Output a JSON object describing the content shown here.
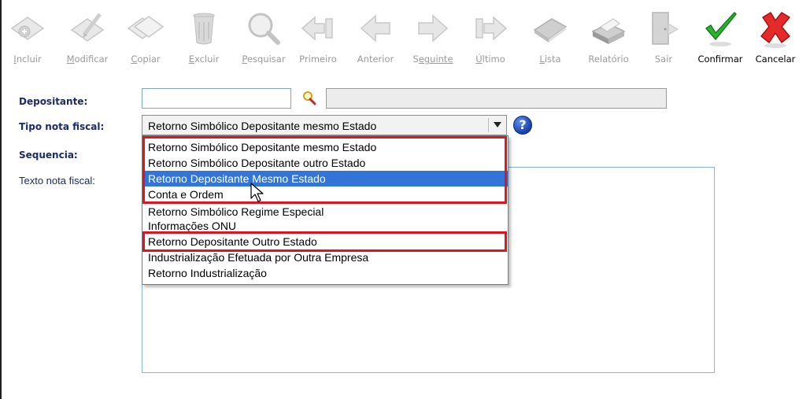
{
  "toolbar": {
    "buttons": [
      {
        "label": "Incluir",
        "ul": "I",
        "rest": "ncluir",
        "active": false
      },
      {
        "label": "Modificar",
        "ul": "M",
        "rest": "odificar",
        "active": false
      },
      {
        "label": "Copiar",
        "ul": "C",
        "rest": "opiar",
        "active": false
      },
      {
        "label": "Excluir",
        "ul": "E",
        "rest": "xcluir",
        "active": false
      },
      {
        "label": "Pesquisar",
        "ul": "P",
        "rest": "esquisar",
        "active": false
      },
      {
        "label": "Primeiro",
        "ul": "",
        "rest": "Primeiro",
        "active": false
      },
      {
        "label": "Anterior",
        "ul": "A",
        "rest": "nterior",
        "active": false
      },
      {
        "label": "Seguinte",
        "ul": "S",
        "rest": "eguinte",
        "active": false
      },
      {
        "label": "Último",
        "ul": "Ú",
        "rest": "ltimo",
        "active": false
      },
      {
        "label": "Lista",
        "ul": "L",
        "rest": "ista",
        "active": false
      },
      {
        "label": "Relatório",
        "ul": "",
        "rest": "Relatório",
        "active": false
      },
      {
        "label": "Sair",
        "ul": "",
        "rest": "Sair",
        "active": false
      },
      {
        "label": "Confirmar",
        "ul": "",
        "rest": "Confirmar",
        "active": true
      },
      {
        "label": "Cancelar",
        "ul": "",
        "rest": "Cancelar",
        "active": true
      }
    ]
  },
  "form": {
    "depositante_label": "Depositante:",
    "depositante_value": "",
    "depositante_name": "",
    "tipo_label": "Tipo nota fiscal:",
    "tipo_value": "Retorno Simbólico Depositante mesmo Estado",
    "sequencia_label": "Sequencia:",
    "texto_label": "Texto nota fiscal:",
    "help_glyph": "?"
  },
  "dropdown": {
    "options": [
      "Retorno Simbólico Depositante mesmo Estado",
      "Retorno Simbólico Depositante outro Estado",
      "Retorno Depositante Mesmo Estado",
      "Conta e Ordem",
      "Retorno Simbólico Regime Especial",
      "Informações ONU",
      "Retorno Depositante Outro Estado",
      "Industrialização Efetuada por Outra Empresa",
      "Retorno Industrialização"
    ],
    "selected_index": 2
  },
  "colors": {
    "highlight": "#e0141e",
    "selection": "#3375d6",
    "label": "#1a2a6c"
  }
}
